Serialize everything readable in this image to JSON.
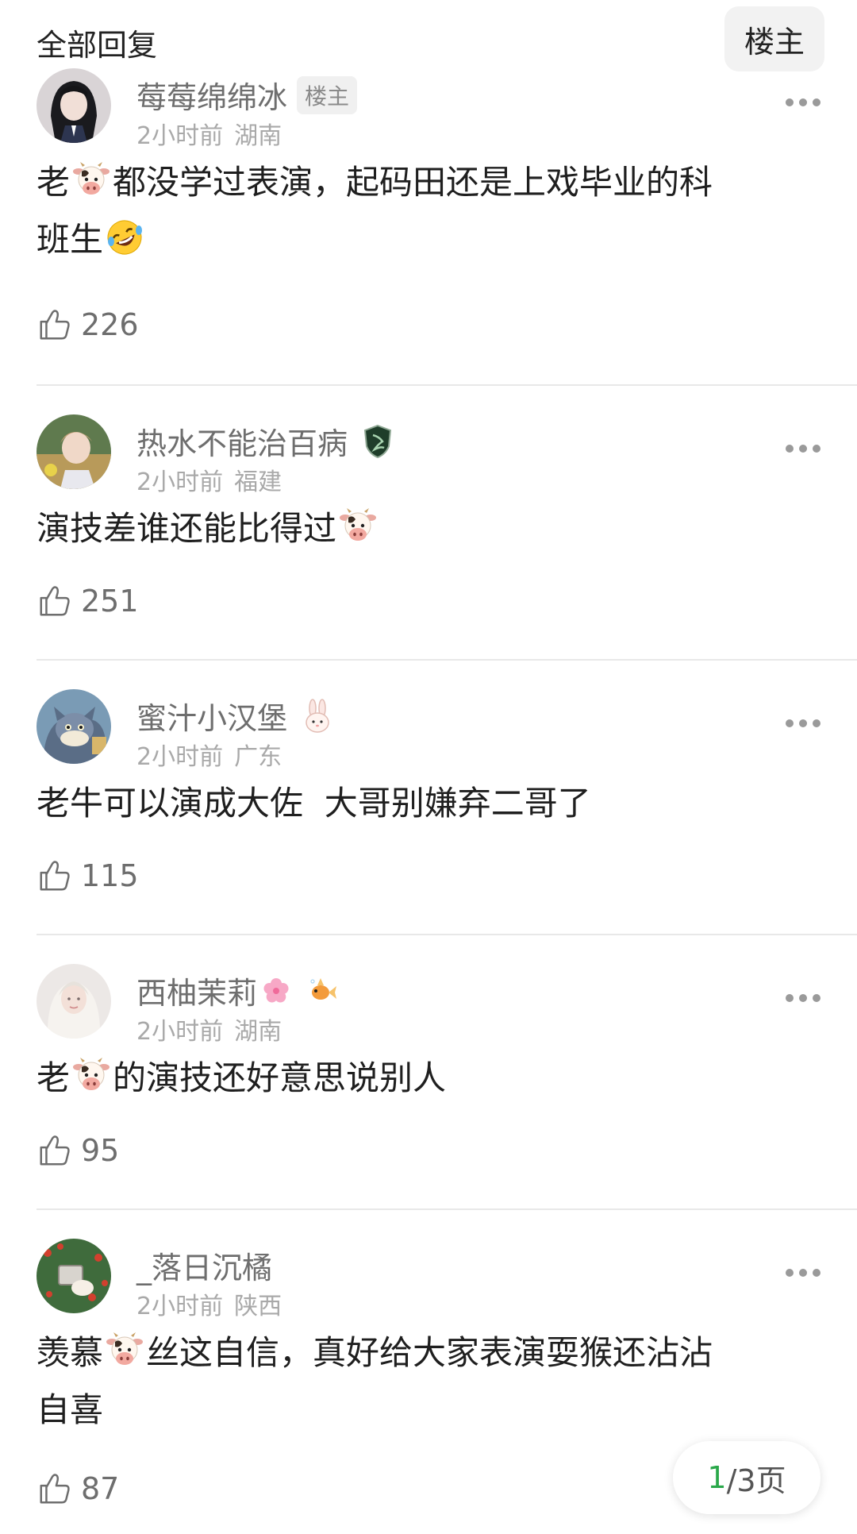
{
  "header": {
    "title": "全部回复",
    "op_filter_label": "楼主"
  },
  "comments": [
    {
      "username": "莓莓绵绵冰",
      "badge": "楼主",
      "time": "2小时前",
      "location": "湖南",
      "text_parts": [
        "老",
        "都没学过表演，起码田还是上戏毕业的科",
        "班生"
      ],
      "likes": "226"
    },
    {
      "username": "热水不能治百病",
      "time": "2小时前",
      "location": "福建",
      "text_parts": [
        "演技差谁还能比得过"
      ],
      "likes": "251"
    },
    {
      "username": "蜜汁小汉堡",
      "time": "2小时前",
      "location": "广东",
      "text_parts": [
        "老牛可以演成大佐  大哥别嫌弃二哥了"
      ],
      "likes": "115"
    },
    {
      "username": "西柚茉莉",
      "time": "2小时前",
      "location": "湖南",
      "text_parts": [
        "老",
        "的演技还好意思说别人"
      ],
      "likes": "95"
    },
    {
      "username": "_落日沉橘",
      "time": "2小时前",
      "location": "陕西",
      "text_parts": [
        "羡慕",
        "丝这自信，真好给大家表演耍猴还沾沾",
        "自喜"
      ],
      "likes": "87"
    }
  ],
  "pager": {
    "current": "1",
    "rest": "/3页"
  },
  "icons": [
    "more-icon",
    "thumbs-up-icon",
    "cow-emoji",
    "rofl-emoji",
    "shield-badge-icon",
    "rabbit-badge-icon",
    "cherry-blossom-emoji",
    "goldfish-badge-icon"
  ]
}
